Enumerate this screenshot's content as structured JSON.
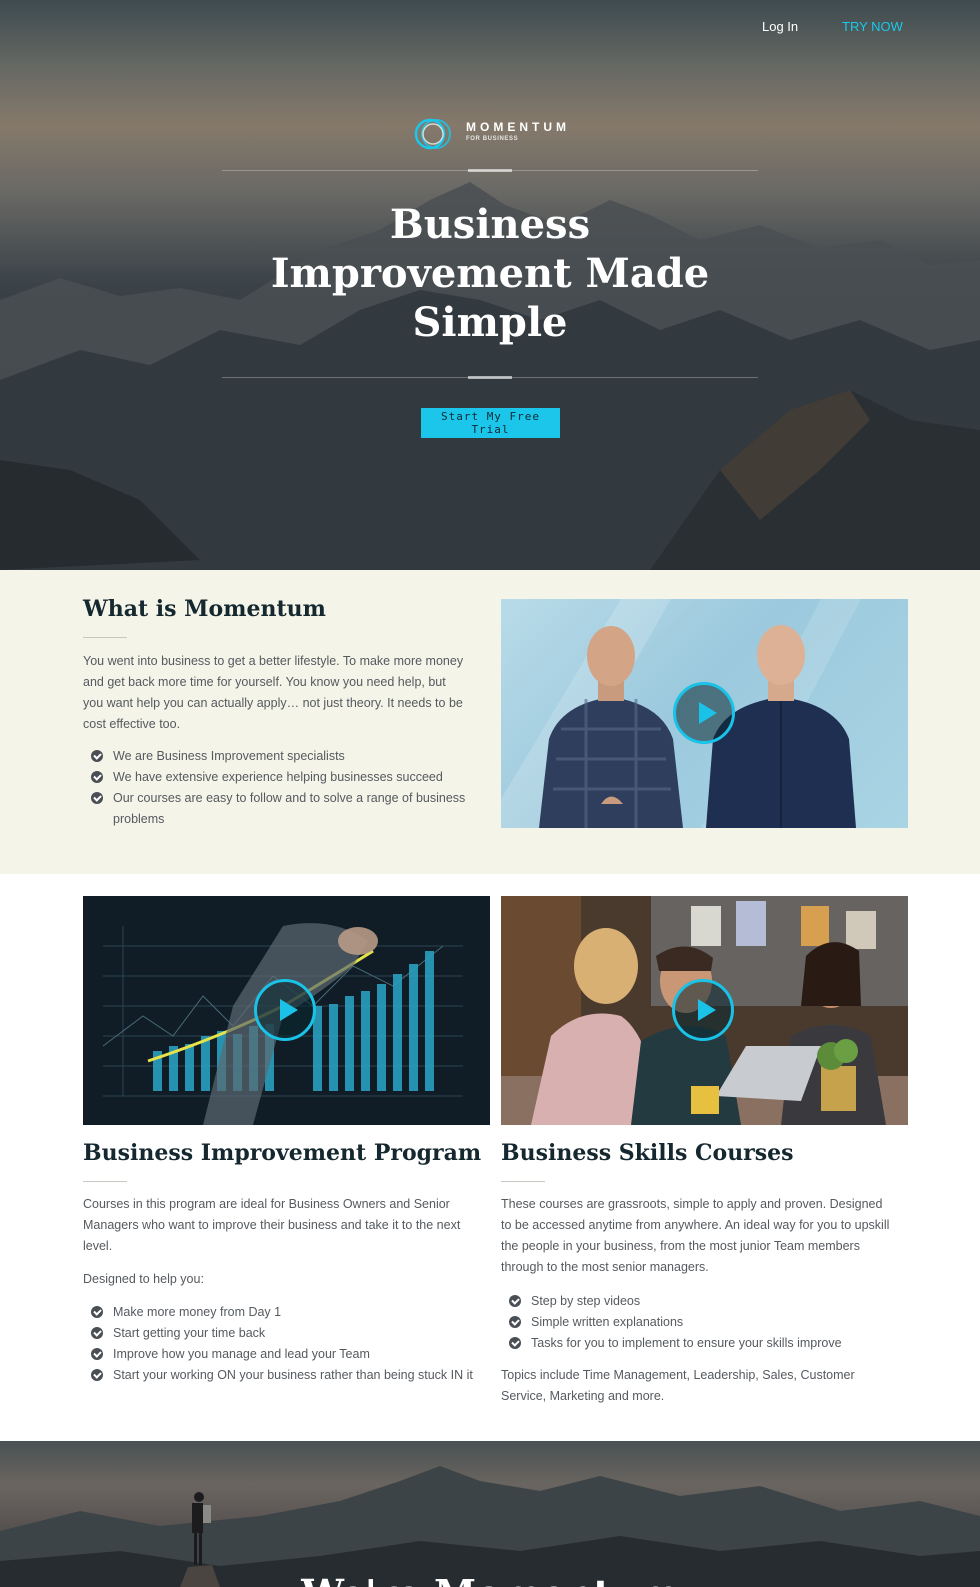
{
  "nav": {
    "login": "Log In",
    "try": "TRY NOW"
  },
  "logo": {
    "wordmark": "MOMENTUM",
    "sub": "FOR BUSINESS"
  },
  "hero": {
    "title_line1": "Business",
    "title_line2": "Improvement Made",
    "title_line3": "Simple",
    "cta": "Start My Free Trial"
  },
  "what": {
    "title": "What is Momentum",
    "body": "You went into business to get a better lifestyle. To make more money and get back more time for yourself. You know you need help, but you want help you can actually apply… not just theory. It needs to be cost effective too.",
    "checks": [
      "We are Business Improvement specialists",
      "We have extensive experience helping businesses succeed",
      "Our courses are easy to follow and to solve a range of business problems"
    ]
  },
  "program": {
    "title": "Business Improvement Program",
    "body": "Courses in this program are ideal for Business Owners and Senior Managers who want to improve their business and take it to the next level.",
    "designed": "Designed to help you:",
    "checks": [
      "Make more money from Day 1",
      "Start getting your time back",
      "Improve how you manage and lead your Team",
      "Start your working ON your business rather than being stuck IN it"
    ]
  },
  "skills": {
    "title": "Business Skills Courses",
    "body": "These courses are grassroots, simple to apply and proven. Designed to be accessed anytime from anywhere. An ideal way for you to upskill the people in your business, from the most junior Team members through to the most senior managers.",
    "checks": [
      "Step by step videos",
      "Simple written explanations",
      "Tasks for you to implement to ensure your skills improve"
    ],
    "topics": "Topics include Time Management, Leadership, Sales, Customer Service, Marketing and more."
  },
  "banner": {
    "title": "We're Momentum"
  },
  "colors": {
    "accent": "#1cc5ea",
    "heading": "#16282f",
    "cream": "#f5f4e9"
  }
}
